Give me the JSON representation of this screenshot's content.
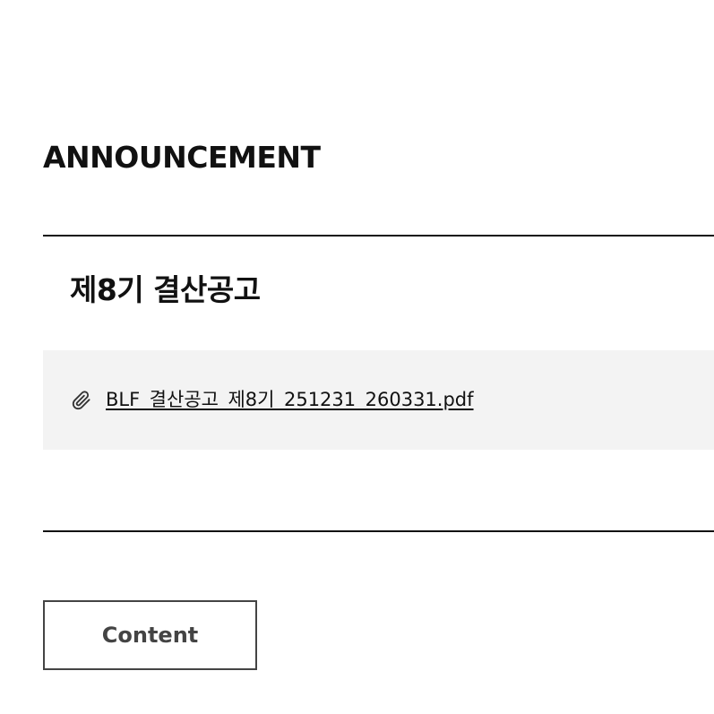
{
  "header": {
    "section_title": "ANNOUNCEMENT"
  },
  "post": {
    "title": "제8기 결산공고",
    "attachment": {
      "icon": "paperclip-icon",
      "filename": "BLF_결산공고_제8기_251231_260331.pdf"
    }
  },
  "actions": {
    "content_button_label": "Content"
  },
  "colors": {
    "text": "#111111",
    "attachment_bg": "#f3f3f3",
    "button_border": "#444444"
  }
}
